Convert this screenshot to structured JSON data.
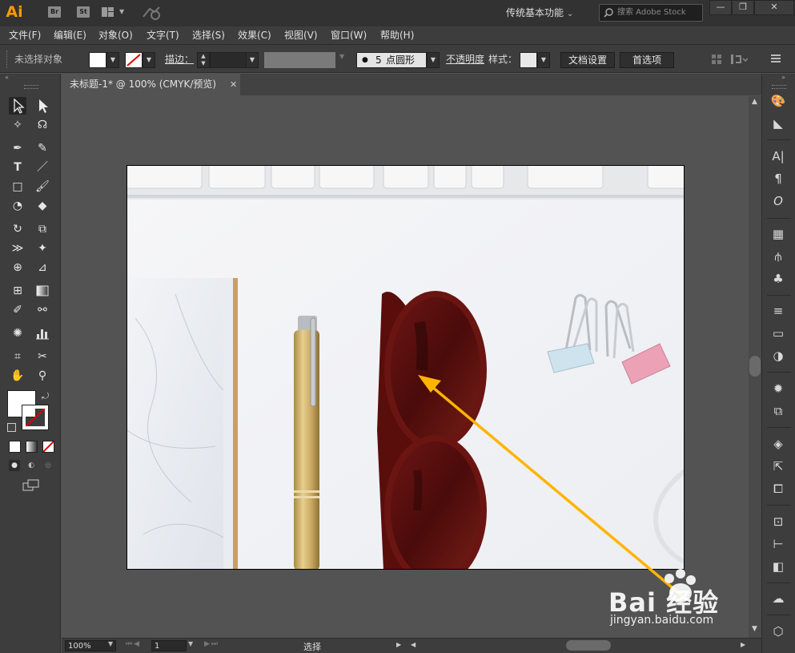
{
  "app": {
    "logo": "Ai",
    "bridge_label": "Br",
    "stock_label": "St",
    "workspace": "传统基本功能",
    "search_placeholder": "搜索 Adobe Stock",
    "window_buttons": {
      "minimize": "—",
      "restore": "❐",
      "close": "✕"
    }
  },
  "menu": [
    "文件(F)",
    "编辑(E)",
    "对象(O)",
    "文字(T)",
    "选择(S)",
    "效果(C)",
    "视图(V)",
    "窗口(W)",
    "帮助(H)"
  ],
  "control_bar": {
    "selection_status": "未选择对象",
    "stroke_label": "描边：",
    "brush_value": "5",
    "brush_label": "点圆形",
    "opacity_label": "不透明度",
    "style_label": "样式：",
    "doc_setup_button": "文档设置",
    "preferences_button": "首选项"
  },
  "document": {
    "tab_title": "未标题-1* @ 100% (CMYK/预览)",
    "tab_close": "✕"
  },
  "status_bar": {
    "zoom": "100%",
    "page": "1",
    "tool_status": "选择"
  },
  "watermark": {
    "brand": "Bai  经验",
    "url": "jingyan.baidu.com"
  },
  "colors": {
    "accent_orange": "#ff9a00",
    "arrow": "#ffb400",
    "panel_bg": "#3d3d3d",
    "canvas_bg": "#535353"
  }
}
